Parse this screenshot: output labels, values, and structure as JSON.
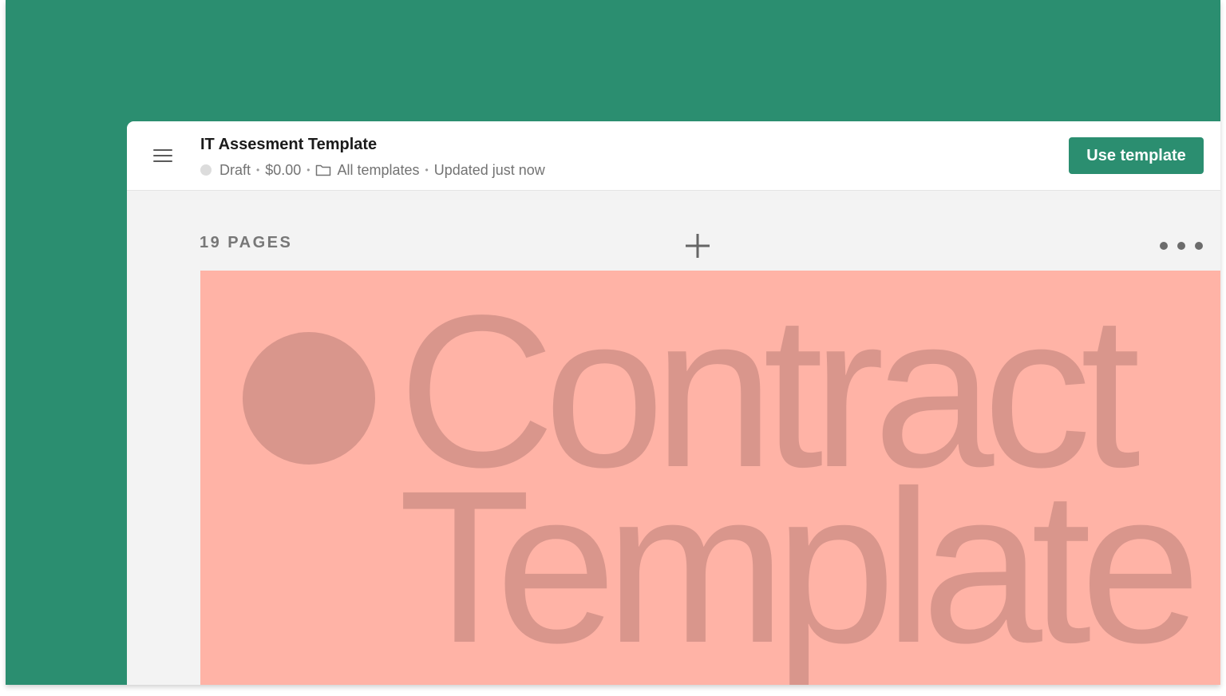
{
  "colors": {
    "brand_green": "#2b8e70",
    "cover_background": "#ffb3a6",
    "cover_ink": "#d9968c",
    "workspace_background": "#f3f3f3"
  },
  "header": {
    "menu_icon": "hamburger-menu-icon",
    "title": "IT Assesment Template",
    "status": "Draft",
    "price": "$0.00",
    "folder_icon": "folder-icon",
    "folder": "All templates",
    "updated": "Updated just now",
    "separator": "•",
    "use_template_label": "Use template"
  },
  "pages": {
    "count_label": "19 PAGES",
    "add_icon": "plus-icon",
    "more_icon": "more-horizontal-icon"
  },
  "cover": {
    "line1": "Contract",
    "line2": "Template"
  }
}
